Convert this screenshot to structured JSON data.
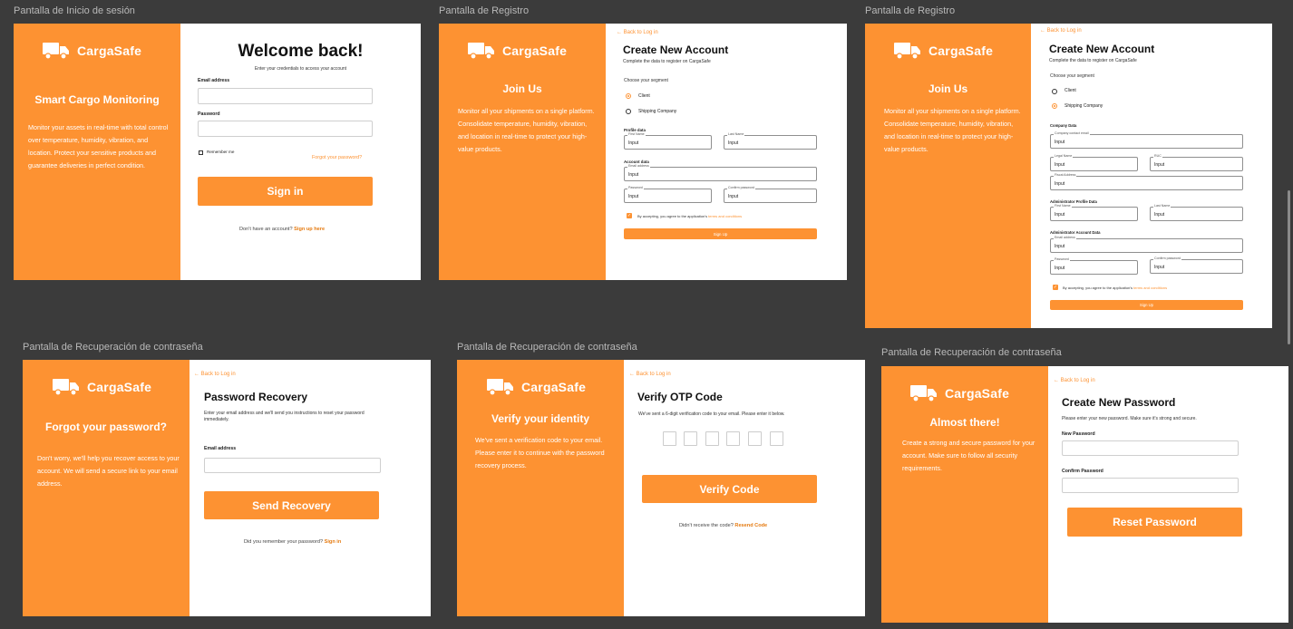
{
  "frames": {
    "login": {
      "label": "Pantalla de Inicio de sesión"
    },
    "register_a": {
      "label": "Pantalla de Registro"
    },
    "register_b": {
      "label": "Pantalla de Registro"
    },
    "recovery": {
      "label": "Pantalla de Recuperación de contraseña"
    },
    "otp": {
      "label": "Pantalla de Recuperación de contraseña"
    },
    "newpass": {
      "label": "Pantalla de Recuperación de contraseña"
    }
  },
  "brand": {
    "name": "CargaSafe"
  },
  "colors": {
    "accent": "#fd9232",
    "canvas": "#3b3b3b",
    "link": "#e57a10"
  },
  "icons": {
    "logo": "truck-icon"
  },
  "login": {
    "side_title": "Smart Cargo Monitoring",
    "side_desc": "Monitor your assets in real-time with total control over temperature, humidity, vibration, and location. Protect your sensitive products and guarantee deliveries in perfect condition.",
    "title": "Welcome back!",
    "subtitle": "Enter your credentials to access your account",
    "email_label": "Email address",
    "password_label": "Password",
    "remember": "Remember me",
    "forgot": "Forgot your password?",
    "button": "Sign in",
    "footer_text": "Don't have an account?",
    "footer_link": "Sign up here"
  },
  "register": {
    "back": "← Back to Log in",
    "side_title": "Join Us",
    "side_desc": "Monitor all your shipments on a single platform. Consolidate temperature, humidity, vibration, and location in real-time to protect your high-value products.",
    "title": "Create New Account",
    "subtitle": "Complete the data to register on CargaSafe",
    "segment_label": "Choose your segment",
    "opt_client": "Client",
    "opt_shipping": "Shipping Company",
    "profile_data": "Profile data",
    "first_name": "First Name",
    "last_name": "Last Name",
    "account_data": "Account data",
    "email": "Email address",
    "password": "Password",
    "confirm_password": "Confirm password",
    "input_value": "Input",
    "terms_text": "By accepting, you agree to the application's",
    "terms_link": "terms and conditions",
    "button": "Sign Up"
  },
  "register_company": {
    "company_data": "Company Data",
    "company_contact_email": "Company contact email",
    "legal_name": "Legal Name",
    "ruc": "RUC",
    "fiscal_address": "Fiscal Address",
    "admin_profile": "Administrator Profile Data",
    "admin_account": "Administrator Account Data"
  },
  "recovery": {
    "side_title": "Forgot your password?",
    "side_desc": "Don't worry, we'll help you recover access to your account. We will send a secure link to your email address.",
    "title": "Password Recovery",
    "subtitle": "Enter your email address and we'll send you instructions to reset your password immediately.",
    "email_label": "Email address",
    "button": "Send Recovery",
    "footer_text": "Did you remember your password?",
    "footer_link": "Sign in"
  },
  "otp": {
    "side_title": "Verify your identity",
    "side_desc": "We've sent a verification code to your email. Please enter it to continue with the password recovery process.",
    "title": "Verify OTP Code",
    "subtitle": "We've sent a 6-digit verification code to your email. Please enter it below.",
    "button": "Verify Code",
    "footer_text": "Didn't receive the code?",
    "footer_link": "Resend Code"
  },
  "newpass": {
    "side_title": "Almost there!",
    "side_desc": "Create a strong and secure password for your account. Make sure to follow all security requirements.",
    "title": "Create New Password",
    "subtitle": "Please enter your new password. Make sure it's strong and secure.",
    "new_label": "New Password",
    "confirm_label": "Confirm Password",
    "button": "Reset Password"
  }
}
